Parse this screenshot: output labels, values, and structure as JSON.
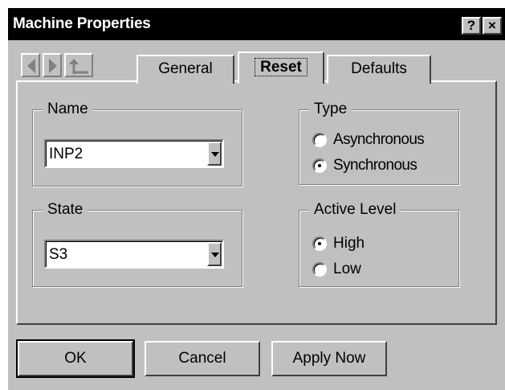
{
  "window": {
    "title": "Machine Properties",
    "help_label": "?",
    "close_label": "×"
  },
  "tabs": [
    {
      "label": "General"
    },
    {
      "label": "Reset"
    },
    {
      "label": "Defaults"
    }
  ],
  "name_group": {
    "label": "Name",
    "selected": "INP2"
  },
  "state_group": {
    "label": "State",
    "selected": "S3"
  },
  "type_group": {
    "label": "Type",
    "options": [
      {
        "label": "Asynchronous",
        "checked": false
      },
      {
        "label": "Synchronous",
        "checked": true
      }
    ]
  },
  "active_level_group": {
    "label": "Active Level",
    "options": [
      {
        "label": "High",
        "checked": true
      },
      {
        "label": "Low",
        "checked": false
      }
    ]
  },
  "buttons": {
    "ok": "OK",
    "cancel": "Cancel",
    "apply": "Apply Now"
  }
}
